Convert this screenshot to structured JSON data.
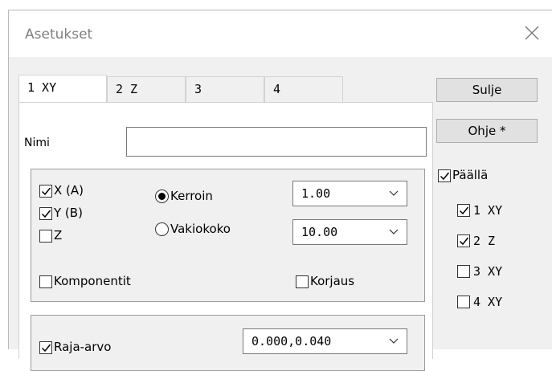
{
  "window": {
    "title": "Asetukset"
  },
  "tabs": [
    {
      "label": "1 XY",
      "active": true
    },
    {
      "label": "2 Z",
      "active": false
    },
    {
      "label": "3",
      "active": false
    },
    {
      "label": "4",
      "active": false
    }
  ],
  "name_field": {
    "label": "Nimi",
    "value": ""
  },
  "group1": {
    "x_label": "X (A)",
    "x_checked": true,
    "y_label": "Y (B)",
    "y_checked": true,
    "z_label": "Z",
    "z_checked": false,
    "radio_factor_label": "Kerroin",
    "radio_factor_selected": true,
    "radio_fixed_label": "Vakiokoko",
    "radio_fixed_selected": false,
    "factor_value": "1.00",
    "fixed_value": "10.00",
    "components_label": "Komponentit",
    "components_checked": false,
    "correction_label": "Korjaus",
    "correction_checked": false
  },
  "group2": {
    "limit_label": "Raja-arvo",
    "limit_checked": true,
    "limit_value": "0.000,0.040"
  },
  "buttons": {
    "close": "Sulje",
    "help": "Ohje *"
  },
  "enabled": {
    "label": "Päällä",
    "checked": true,
    "items": [
      {
        "label": "1 XY",
        "checked": true
      },
      {
        "label": "2 Z",
        "checked": true
      },
      {
        "label": "3 XY",
        "checked": false
      },
      {
        "label": "4 XY",
        "checked": false
      }
    ]
  }
}
